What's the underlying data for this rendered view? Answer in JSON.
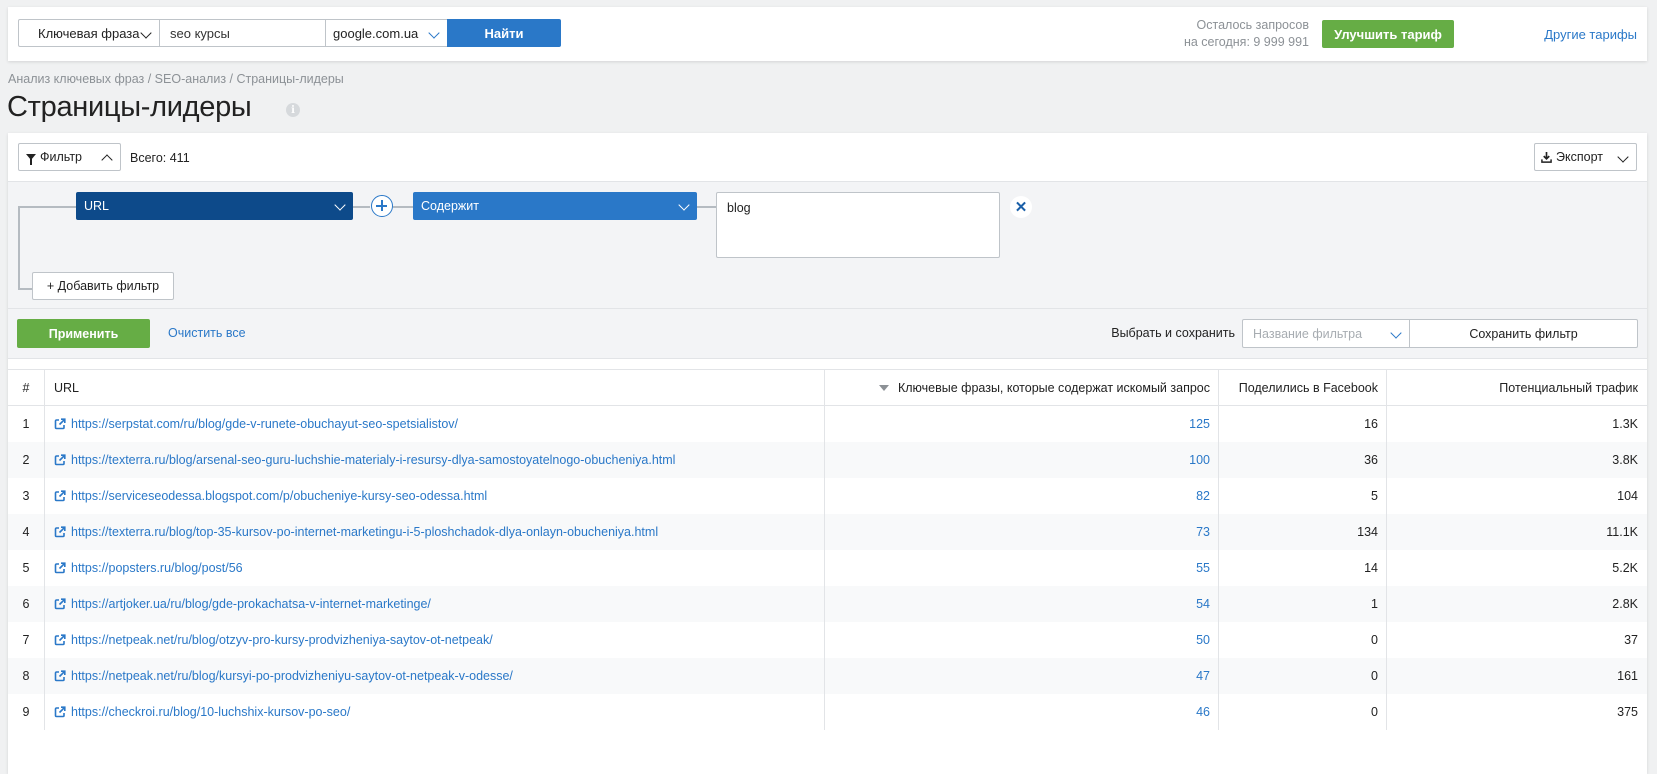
{
  "search": {
    "type": "Ключевая фраза",
    "query": "seo курсы",
    "database": "google.com.ua",
    "button": "Найти"
  },
  "account": {
    "quota_line1": "Осталось запросов",
    "quota_line2": "на сегодня: 9 999 991",
    "upgrade": "Улучшить тариф",
    "other_plans": "Другие тарифы"
  },
  "breadcrumb": "Анализ ключевых фраз / SEO-анализ / Страницы-лидеры",
  "page_title": "Страницы-лидеры",
  "toolbar": {
    "filter": "Фильтр",
    "total": "Всего: 411",
    "export": "Экспорт"
  },
  "filter": {
    "field": "URL",
    "operator": "Содержит",
    "value": "blog",
    "add_filter": "+ Добавить фильтр",
    "apply": "Применить",
    "clear_all": "Очистить все",
    "choose_save": "Выбрать и сохранить",
    "name_placeholder": "Название фильтра",
    "save_filter": "Сохранить фильтр"
  },
  "table": {
    "columns": [
      "#",
      "URL",
      "Ключевые фразы, которые содержат искомый запрос",
      "Поделились в Facebook",
      "Потенциальный трафик"
    ],
    "rows": [
      {
        "n": "1",
        "url": "https://serpstat.com/ru/blog/gde-v-runete-obuchayut-seo-spetsialistov/",
        "kw": "125",
        "fb": "16",
        "traffic": "1.3K"
      },
      {
        "n": "2",
        "url": "https://texterra.ru/blog/arsenal-seo-guru-luchshie-materialy-i-resursy-dlya-samostoyatelnogo-obucheniya.html",
        "kw": "100",
        "fb": "36",
        "traffic": "3.8K"
      },
      {
        "n": "3",
        "url": "https://serviceseodessa.blogspot.com/p/obucheniye-kursy-seo-odessa.html",
        "kw": "82",
        "fb": "5",
        "traffic": "104"
      },
      {
        "n": "4",
        "url": "https://texterra.ru/blog/top-35-kursov-po-internet-marketingu-i-5-ploshchadok-dlya-onlayn-obucheniya.html",
        "kw": "73",
        "fb": "134",
        "traffic": "11.1K"
      },
      {
        "n": "5",
        "url": "https://popsters.ru/blog/post/56",
        "kw": "55",
        "fb": "14",
        "traffic": "5.2K"
      },
      {
        "n": "6",
        "url": "https://artjoker.ua/ru/blog/gde-prokachatsa-v-internet-marketinge/",
        "kw": "54",
        "fb": "1",
        "traffic": "2.8K"
      },
      {
        "n": "7",
        "url": "https://netpeak.net/ru/blog/otzyv-pro-kursy-prodvizheniya-saytov-ot-netpeak/",
        "kw": "50",
        "fb": "0",
        "traffic": "37"
      },
      {
        "n": "8",
        "url": "https://netpeak.net/ru/blog/kursyi-po-prodvizheniyu-saytov-ot-netpeak-v-odesse/",
        "kw": "47",
        "fb": "0",
        "traffic": "161"
      },
      {
        "n": "9",
        "url": "https://checkroi.ru/blog/10-luchshix-kursov-po-seo/",
        "kw": "46",
        "fb": "0",
        "traffic": "375"
      }
    ]
  },
  "colors": {
    "accent": "#2a78c8",
    "dark_accent": "#0d4a8a",
    "green": "#66ad45"
  }
}
